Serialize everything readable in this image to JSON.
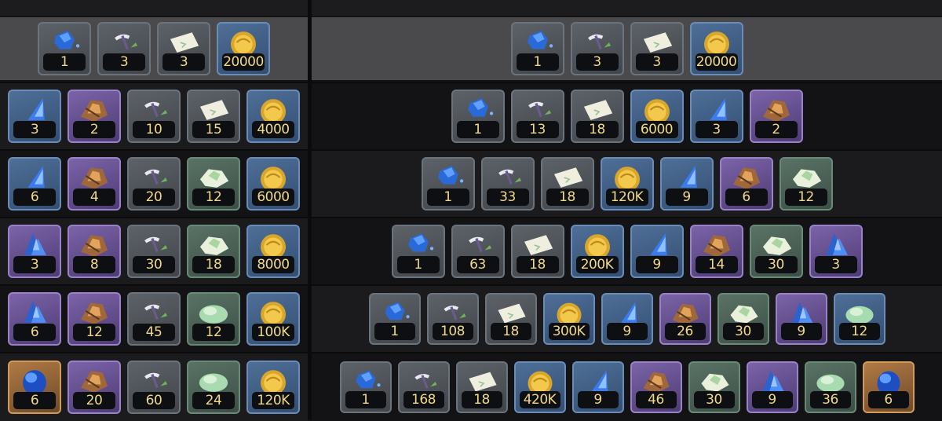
{
  "left_column": {
    "header_row": [
      {
        "icon": "blue-crystal-icon",
        "count": "1",
        "bg": "gray"
      },
      {
        "icon": "pickaxe-icon",
        "count": "3",
        "bg": "gray"
      },
      {
        "icon": "paper-scroll-icon",
        "count": "3",
        "bg": "gray"
      },
      {
        "icon": "gold-coin-icon",
        "count": "20000",
        "bg": "blue"
      }
    ],
    "rows": [
      [
        {
          "icon": "blue-shard-icon",
          "count": "3",
          "bg": "blue"
        },
        {
          "icon": "bronze-ore-icon",
          "count": "2",
          "bg": "purple"
        },
        {
          "icon": "pickaxe-icon",
          "count": "10",
          "bg": "gray"
        },
        {
          "icon": "paper-scroll-icon",
          "count": "15",
          "bg": "gray"
        },
        {
          "icon": "gold-coin-icon",
          "count": "4000",
          "bg": "blue"
        }
      ],
      [
        {
          "icon": "blue-shard-icon",
          "count": "6",
          "bg": "blue"
        },
        {
          "icon": "bronze-ore-icon",
          "count": "4",
          "bg": "purple"
        },
        {
          "icon": "pickaxe-icon",
          "count": "20",
          "bg": "gray"
        },
        {
          "icon": "green-ore-icon",
          "count": "12",
          "bg": "green"
        },
        {
          "icon": "gold-coin-icon",
          "count": "6000",
          "bg": "blue"
        }
      ],
      [
        {
          "icon": "blue-crystal-cluster-icon",
          "count": "3",
          "bg": "purple"
        },
        {
          "icon": "bronze-ore-icon",
          "count": "8",
          "bg": "purple"
        },
        {
          "icon": "pickaxe-icon",
          "count": "30",
          "bg": "gray"
        },
        {
          "icon": "green-ore-icon",
          "count": "18",
          "bg": "green"
        },
        {
          "icon": "gold-coin-icon",
          "count": "8000",
          "bg": "blue"
        }
      ],
      [
        {
          "icon": "blue-crystal-cluster-icon",
          "count": "6",
          "bg": "purple"
        },
        {
          "icon": "bronze-ore-icon",
          "count": "12",
          "bg": "purple"
        },
        {
          "icon": "pickaxe-icon",
          "count": "45",
          "bg": "gray"
        },
        {
          "icon": "green-ore-lump-icon",
          "count": "12",
          "bg": "green"
        },
        {
          "icon": "gold-coin-icon",
          "count": "100K",
          "bg": "blue"
        }
      ],
      [
        {
          "icon": "blue-gem-orb-icon",
          "count": "6",
          "bg": "orange"
        },
        {
          "icon": "bronze-ore-icon",
          "count": "20",
          "bg": "purple"
        },
        {
          "icon": "pickaxe-icon",
          "count": "60",
          "bg": "gray"
        },
        {
          "icon": "green-ore-lump-icon",
          "count": "24",
          "bg": "green"
        },
        {
          "icon": "gold-coin-icon",
          "count": "120K",
          "bg": "blue"
        }
      ]
    ]
  },
  "right_column": {
    "header_row": [
      {
        "icon": "blue-crystal-icon",
        "count": "1",
        "bg": "gray"
      },
      {
        "icon": "pickaxe-icon",
        "count": "3",
        "bg": "gray"
      },
      {
        "icon": "paper-scroll-icon",
        "count": "3",
        "bg": "gray"
      },
      {
        "icon": "gold-coin-icon",
        "count": "20000",
        "bg": "blue"
      }
    ],
    "rows": [
      [
        {
          "icon": "blue-crystal-icon",
          "count": "1",
          "bg": "gray"
        },
        {
          "icon": "pickaxe-icon",
          "count": "13",
          "bg": "gray"
        },
        {
          "icon": "paper-scroll-icon",
          "count": "18",
          "bg": "gray"
        },
        {
          "icon": "gold-coin-icon",
          "count": "6000",
          "bg": "blue"
        },
        {
          "icon": "blue-shard-icon",
          "count": "3",
          "bg": "blue"
        },
        {
          "icon": "bronze-ore-icon",
          "count": "2",
          "bg": "purple"
        }
      ],
      [
        {
          "icon": "blue-crystal-icon",
          "count": "1",
          "bg": "gray"
        },
        {
          "icon": "pickaxe-icon",
          "count": "33",
          "bg": "gray"
        },
        {
          "icon": "paper-scroll-icon",
          "count": "18",
          "bg": "gray"
        },
        {
          "icon": "gold-coin-icon",
          "count": "120K",
          "bg": "blue"
        },
        {
          "icon": "blue-shard-icon",
          "count": "9",
          "bg": "blue"
        },
        {
          "icon": "bronze-ore-icon",
          "count": "6",
          "bg": "purple"
        },
        {
          "icon": "green-ore-icon",
          "count": "12",
          "bg": "green"
        }
      ],
      [
        {
          "icon": "blue-crystal-icon",
          "count": "1",
          "bg": "gray"
        },
        {
          "icon": "pickaxe-icon",
          "count": "63",
          "bg": "gray"
        },
        {
          "icon": "paper-scroll-icon",
          "count": "18",
          "bg": "gray"
        },
        {
          "icon": "gold-coin-icon",
          "count": "200K",
          "bg": "blue"
        },
        {
          "icon": "blue-shard-icon",
          "count": "9",
          "bg": "blue"
        },
        {
          "icon": "bronze-ore-icon",
          "count": "14",
          "bg": "purple"
        },
        {
          "icon": "green-ore-icon",
          "count": "30",
          "bg": "green"
        },
        {
          "icon": "blue-crystal-cluster-icon",
          "count": "3",
          "bg": "purple"
        }
      ],
      [
        {
          "icon": "blue-crystal-icon",
          "count": "1",
          "bg": "gray"
        },
        {
          "icon": "pickaxe-icon",
          "count": "108",
          "bg": "gray"
        },
        {
          "icon": "paper-scroll-icon",
          "count": "18",
          "bg": "gray"
        },
        {
          "icon": "gold-coin-icon",
          "count": "300K",
          "bg": "blue"
        },
        {
          "icon": "blue-shard-icon",
          "count": "9",
          "bg": "blue"
        },
        {
          "icon": "bronze-ore-icon",
          "count": "26",
          "bg": "purple"
        },
        {
          "icon": "green-ore-icon",
          "count": "30",
          "bg": "green"
        },
        {
          "icon": "blue-crystal-cluster-icon",
          "count": "9",
          "bg": "purple"
        },
        {
          "icon": "green-ore-lump-icon",
          "count": "12",
          "bg": "blue"
        }
      ],
      [
        {
          "icon": "blue-crystal-icon",
          "count": "1",
          "bg": "gray"
        },
        {
          "icon": "pickaxe-icon",
          "count": "168",
          "bg": "gray"
        },
        {
          "icon": "paper-scroll-icon",
          "count": "18",
          "bg": "gray"
        },
        {
          "icon": "gold-coin-icon",
          "count": "420K",
          "bg": "blue"
        },
        {
          "icon": "blue-shard-icon",
          "count": "9",
          "bg": "blue"
        },
        {
          "icon": "bronze-ore-icon",
          "count": "46",
          "bg": "purple"
        },
        {
          "icon": "green-ore-icon",
          "count": "30",
          "bg": "green"
        },
        {
          "icon": "blue-crystal-cluster-icon",
          "count": "9",
          "bg": "purple"
        },
        {
          "icon": "green-ore-lump-icon",
          "count": "36",
          "bg": "green"
        },
        {
          "icon": "blue-gem-orb-icon",
          "count": "6",
          "bg": "orange"
        }
      ]
    ]
  }
}
